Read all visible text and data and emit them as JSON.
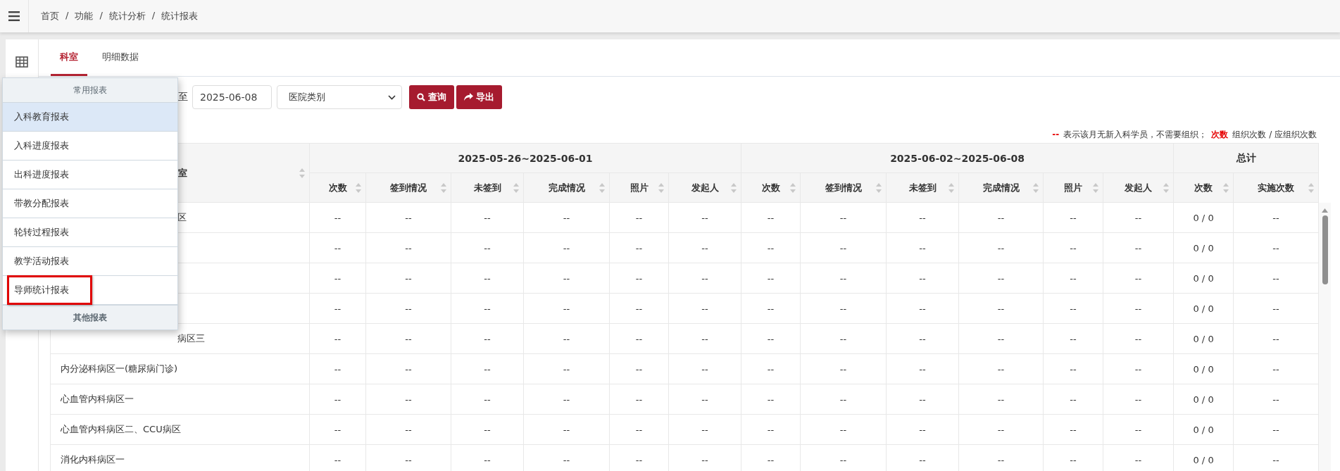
{
  "breadcrumb": {
    "items": [
      "首页",
      "功能",
      "统计分析",
      "统计报表"
    ],
    "separator": "/"
  },
  "tabs": [
    {
      "label": "科室",
      "selected": true
    },
    {
      "label": "明细数据",
      "selected": false
    }
  ],
  "toolbar": {
    "range_word": "至",
    "end_date": "2025-06-08",
    "hospital_type": "医院类别",
    "buttons": [
      {
        "label": "查询",
        "kind": "search"
      },
      {
        "label": "导出",
        "kind": "export"
      }
    ]
  },
  "legend": [
    {
      "text": "--",
      "kind": "mark"
    },
    {
      "text": "表示该月无新入科学员，不需要组织；",
      "kind": "plain"
    },
    {
      "text": "次数",
      "kind": "mark"
    },
    {
      "text": "组织次数 / 应组织次数",
      "kind": "plain"
    }
  ],
  "table": {
    "name_column": {
      "label": "室",
      "cut": true
    },
    "groups": [
      {
        "label": "2025-05-26~2025-06-01",
        "columns": [
          "次数",
          "签到情况",
          "未签到",
          "完成情况",
          "照片",
          "发起人"
        ]
      },
      {
        "label": "2025-06-02~2025-06-08",
        "columns": [
          "次数",
          "签到情况",
          "未签到",
          "完成情况",
          "照片",
          "发起人"
        ]
      },
      {
        "label": "总计",
        "columns": [
          "次数",
          "实施次数"
        ]
      }
    ],
    "rows": [
      {
        "name": "区",
        "cut": true,
        "cells": [
          "--",
          "--",
          "--",
          "--",
          "--",
          "--",
          "--",
          "--",
          "--",
          "--",
          "--",
          "--",
          "0 / 0",
          "--"
        ]
      },
      {
        "cells": [
          "--",
          "--",
          "--",
          "--",
          "--",
          "--",
          "--",
          "--",
          "--",
          "--",
          "--",
          "--",
          "0 / 0",
          "--"
        ]
      },
      {
        "cells": [
          "--",
          "--",
          "--",
          "--",
          "--",
          "--",
          "--",
          "--",
          "--",
          "--",
          "--",
          "--",
          "0 / 0",
          "--"
        ]
      },
      {
        "cells": [
          "--",
          "--",
          "--",
          "--",
          "--",
          "--",
          "--",
          "--",
          "--",
          "--",
          "--",
          "--",
          "0 / 0",
          "--"
        ]
      },
      {
        "name": "病区三",
        "cut": true,
        "cells": [
          "--",
          "--",
          "--",
          "--",
          "--",
          "--",
          "--",
          "--",
          "--",
          "--",
          "--",
          "--",
          "0 / 0",
          "--"
        ]
      },
      {
        "name": "内分泌科病区一(糖尿病门诊)",
        "cells": [
          "--",
          "--",
          "--",
          "--",
          "--",
          "--",
          "--",
          "--",
          "--",
          "--",
          "--",
          "--",
          "0 / 0",
          "--"
        ]
      },
      {
        "name": "心血管内科病区一",
        "cells": [
          "--",
          "--",
          "--",
          "--",
          "--",
          "--",
          "--",
          "--",
          "--",
          "--",
          "--",
          "--",
          "0 / 0",
          "--"
        ]
      },
      {
        "name": "心血管内科病区二、CCU病区",
        "cells": [
          "--",
          "--",
          "--",
          "--",
          "--",
          "--",
          "--",
          "--",
          "--",
          "--",
          "--",
          "--",
          "0 / 0",
          "--"
        ]
      },
      {
        "name": "消化内科病区一",
        "cells": [
          "--",
          "--",
          "--",
          "--",
          "--",
          "--",
          "--",
          "--",
          "--",
          "--",
          "--",
          "--",
          "0 / 0",
          "--"
        ]
      }
    ]
  },
  "menu": {
    "header": "常用报表",
    "items": [
      {
        "label": "入科教育报表",
        "selected": true,
        "annotated": false
      },
      {
        "label": "入科进度报表",
        "selected": false,
        "annotated": false
      },
      {
        "label": "出科进度报表",
        "selected": false,
        "annotated": false
      },
      {
        "label": "带教分配报表",
        "selected": false,
        "annotated": false
      },
      {
        "label": "轮转过程报表",
        "selected": false,
        "annotated": false
      },
      {
        "label": "教学活动报表",
        "selected": false,
        "annotated": false
      },
      {
        "label": "导师统计报表",
        "selected": false,
        "annotated": true
      }
    ],
    "footer": "其他报表"
  }
}
